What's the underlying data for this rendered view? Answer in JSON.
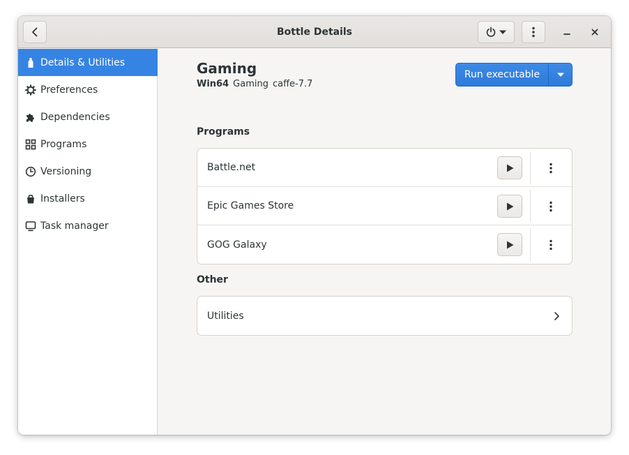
{
  "window": {
    "title": "Bottle Details"
  },
  "sidebar": {
    "items": [
      {
        "label": "Details & Utilities",
        "icon": "bottle-icon",
        "active": true
      },
      {
        "label": "Preferences",
        "icon": "gear-icon"
      },
      {
        "label": "Dependencies",
        "icon": "puzzle-icon"
      },
      {
        "label": "Programs",
        "icon": "grid-icon"
      },
      {
        "label": "Versioning",
        "icon": "clock-icon"
      },
      {
        "label": "Installers",
        "icon": "bag-icon"
      },
      {
        "label": "Task manager",
        "icon": "monitor-icon"
      }
    ]
  },
  "bottle": {
    "name": "Gaming",
    "arch": "Win64",
    "environment": "Gaming",
    "runner": "caffe-7.7"
  },
  "actions": {
    "run_label": "Run executable"
  },
  "programs": {
    "title": "Programs",
    "items": [
      {
        "label": "Battle.net"
      },
      {
        "label": "Epic Games Store"
      },
      {
        "label": "GOG Galaxy"
      }
    ]
  },
  "other": {
    "title": "Other",
    "items": [
      {
        "label": "Utilities"
      }
    ]
  },
  "colors": {
    "accent": "#3584e4",
    "text": "#2e3436",
    "background": "#f6f5f4"
  }
}
